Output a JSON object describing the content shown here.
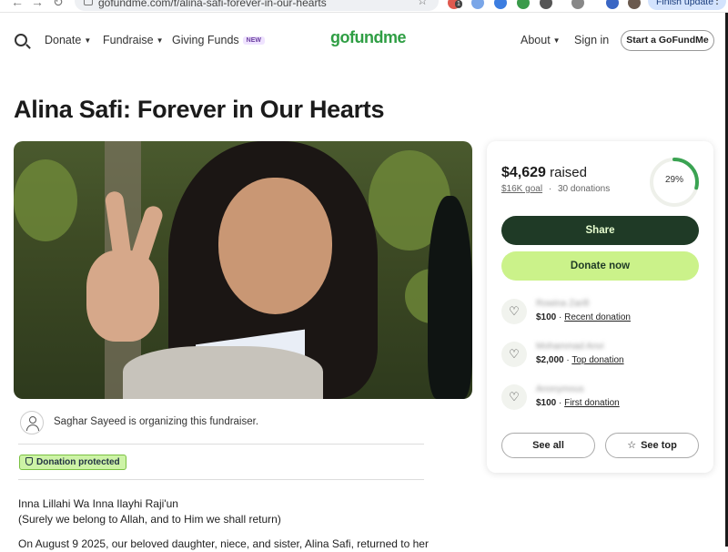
{
  "browser": {
    "url": "gofundme.com/f/alina-safi-forever-in-our-hearts",
    "update_button": "Finish update",
    "extension_badge": "1"
  },
  "header": {
    "nav": [
      {
        "label": "Donate"
      },
      {
        "label": "Fundraise"
      },
      {
        "label": "Giving Funds",
        "badge": "NEW"
      }
    ],
    "logo": "gofundme",
    "about": "About",
    "sign_in": "Sign in",
    "start_button": "Start a GoFundMe"
  },
  "campaign": {
    "title": "Alina Safi: Forever in Our Hearts",
    "organizer_text": "Saghar Sayeed is organizing this fundraiser.",
    "protected_label": "Donation protected",
    "story_lines": [
      "Inna Lillahi Wa Inna Ilayhi Raji'un",
      "(Surely we belong to Allah, and to Him we shall return)",
      "On August 9 2025, our beloved daughter, niece, and sister, Alina Safi, returned to her"
    ]
  },
  "donation_card": {
    "raised_amount": "$4,629",
    "raised_label": "raised",
    "goal": "$16K goal",
    "donations_count": "30 donations",
    "progress_fraction": 0.29,
    "progress_label": "29%",
    "share_button": "Share",
    "donate_button": "Donate now",
    "donors": [
      {
        "name": "Rowina Zarifi",
        "amount": "$100",
        "tag": "Recent donation"
      },
      {
        "name": "Mohammad Anvi",
        "amount": "$2,000",
        "tag": "Top donation"
      },
      {
        "name": "Anonymous",
        "amount": "$100",
        "tag": "First donation"
      }
    ],
    "see_all_button": "See all",
    "see_top_button": "See top"
  },
  "colors": {
    "brand_green": "#2f9e44",
    "share_bg": "#1f3a26",
    "donate_bg": "#cbf28a",
    "progress": "#3aa352",
    "protected_bg": "#cdf3a6"
  }
}
